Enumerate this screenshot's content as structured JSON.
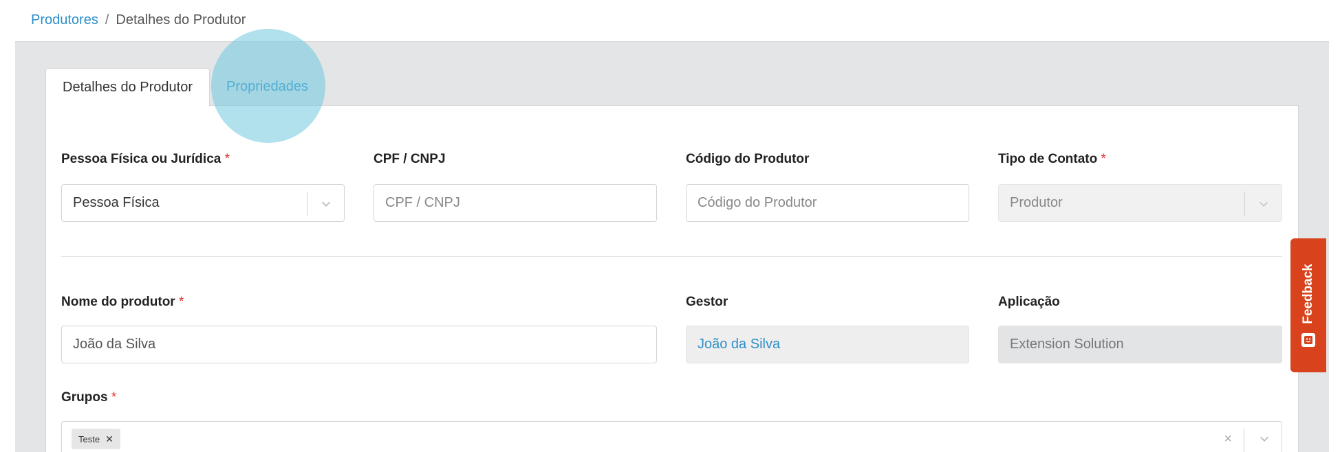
{
  "breadcrumb": {
    "root": "Produtores",
    "separator": "/",
    "current": "Detalhes do Produtor"
  },
  "tabs": [
    {
      "label": "Detalhes do Produtor",
      "active": true
    },
    {
      "label": "Propriedades",
      "active": false
    }
  ],
  "form": {
    "person_type": {
      "label": "Pessoa Física ou Jurídica",
      "required": "*",
      "value": "Pessoa Física"
    },
    "cpf_cnpj": {
      "label": "CPF / CNPJ",
      "placeholder": "CPF / CNPJ"
    },
    "producer_code": {
      "label": "Código do Produtor",
      "placeholder": "Código do Produtor"
    },
    "contact_type": {
      "label": "Tipo de Contato",
      "required": "*",
      "value": "Produtor"
    },
    "producer_name": {
      "label": "Nome do produtor",
      "required": "*",
      "value": "João da Silva"
    },
    "manager": {
      "label": "Gestor",
      "value": "João da Silva"
    },
    "application": {
      "label": "Aplicação",
      "value": "Extension Solution"
    },
    "groups": {
      "label": "Grupos",
      "required": "*",
      "tags": [
        "Teste"
      ],
      "clear": "×"
    }
  },
  "feedback": {
    "label": "Feedback"
  },
  "icons": {
    "select": "chevron-down-icon",
    "feedback": "feedback-icon"
  },
  "colors": {
    "link": "#2e8fc7",
    "required": "#e0322d",
    "feedback_bg": "#d8431d",
    "panel_bg": "#e4e5e7"
  }
}
